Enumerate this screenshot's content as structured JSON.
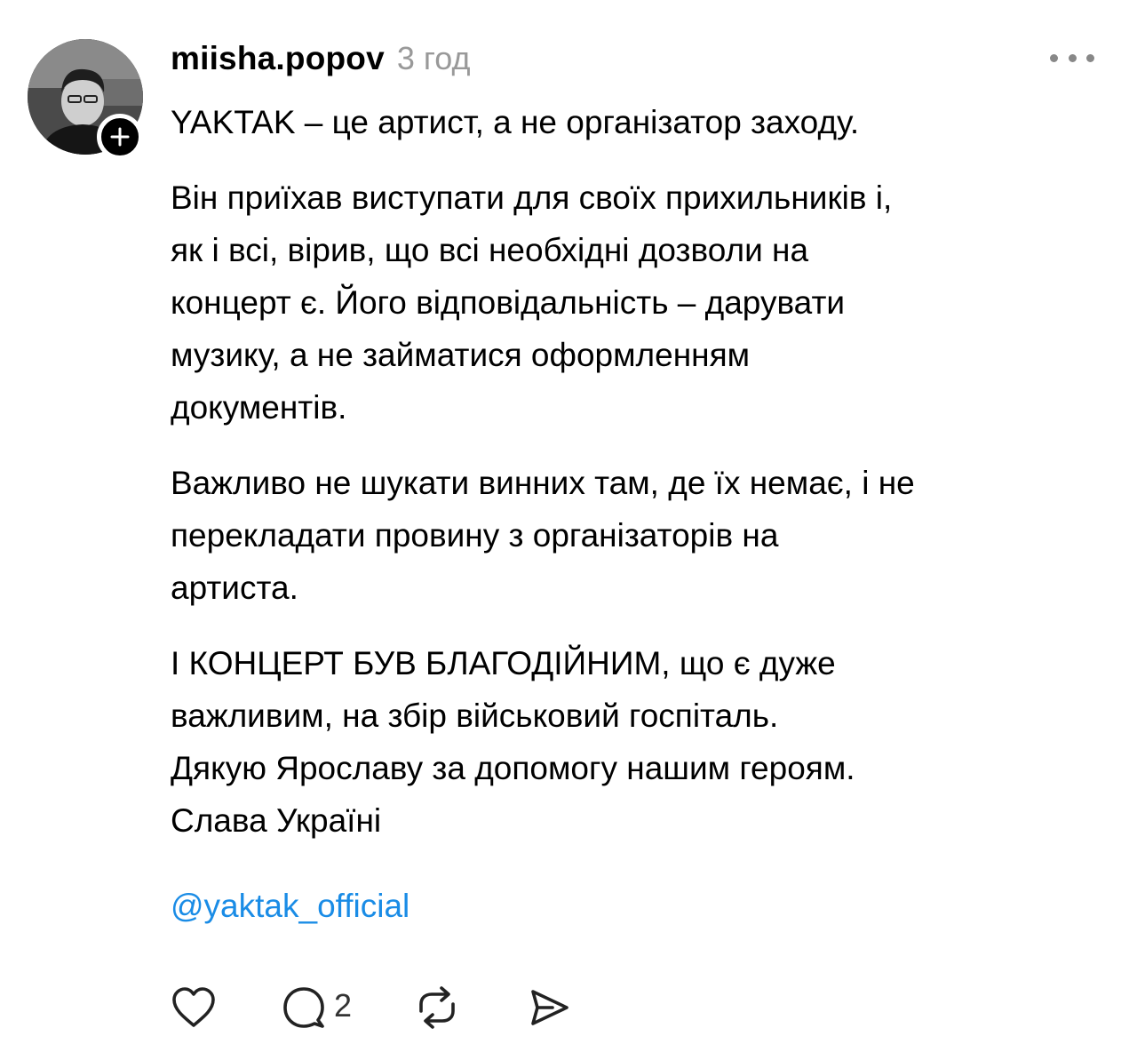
{
  "post": {
    "author": {
      "username": "miisha.popov",
      "avatar_icon": "profile-photo",
      "follow_icon": "plus-icon"
    },
    "timestamp": "3 год",
    "more_icon": "ellipsis-icon",
    "paragraphs": [
      "YAKTAK – це артист, а не організатор заходу.",
      "Він приїхав виступати для своїх прихильників і,\nяк і всі, вірив, що всі необхідні дозволи на\nконцерт є. Його відповідальність – дарувати\nмузику, а не займатися оформленням\nдокументів.",
      "Важливо не шукати винних там, де їх немає, і не\nперекладати провину з організаторів на\nартиста.",
      "І КОНЦЕРТ БУВ БЛАГОДІЙНИМ, що є дуже\nважливим, на збір військовий госпіталь.",
      "Дякую Ярославу за допомогу нашим героям.",
      "Слава Україні"
    ],
    "flag_icon": "ukraine-flag-emoji",
    "mention": "@yaktak_official",
    "actions": {
      "like_icon": "heart-icon",
      "reply_icon": "comment-icon",
      "reply_count": "2",
      "repost_icon": "repost-icon",
      "share_icon": "send-icon"
    }
  },
  "colors": {
    "link": "#1a8ce6",
    "timestamp": "#999999",
    "text": "#000000",
    "flag_blue": "#1f6fd1",
    "flag_yellow": "#f5cd1e"
  }
}
